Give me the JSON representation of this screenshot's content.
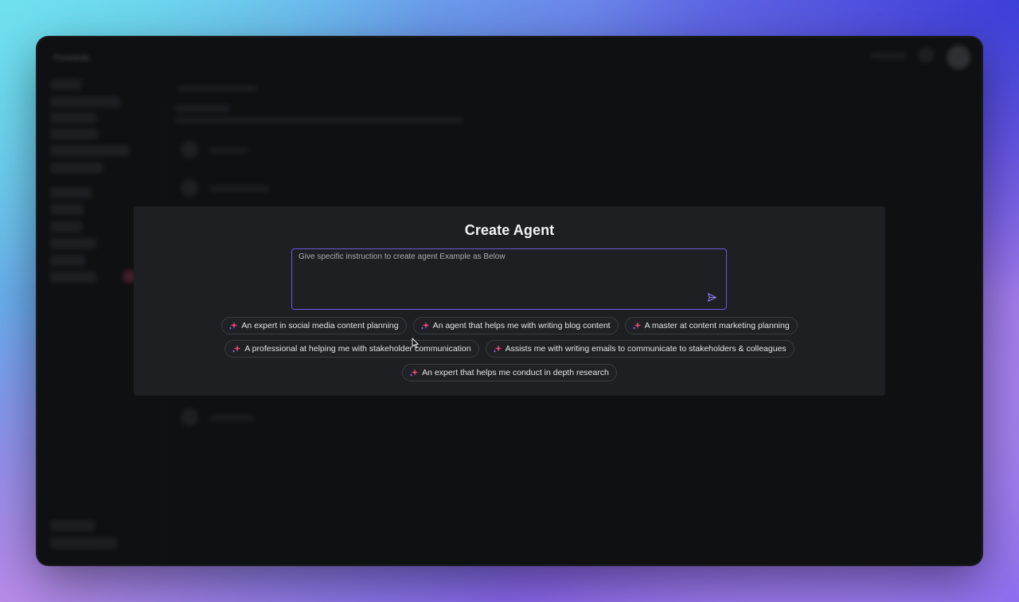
{
  "background_app": {
    "brand": "Forwards"
  },
  "modal": {
    "title": "Create Agent",
    "prompt": {
      "placeholder": "Give specific instruction to create agent Example as Below",
      "value": ""
    },
    "send_icon": "send-icon",
    "suggestions": [
      [
        {
          "label": "An expert in social media content planning",
          "icon": "sparkle-icon"
        },
        {
          "label": "An agent that helps me with writing blog content",
          "icon": "sparkle-icon"
        },
        {
          "label": "A master at content marketing planning",
          "icon": "sparkle-icon"
        }
      ],
      [
        {
          "label": "A professional at helping me with stakeholder communication",
          "icon": "sparkle-icon"
        },
        {
          "label": "Assists me with writing emails to communicate to stakeholders & colleagues",
          "icon": "sparkle-icon"
        }
      ],
      [
        {
          "label": "An expert that helps me conduct in depth research",
          "icon": "sparkle-icon"
        }
      ]
    ]
  },
  "colors": {
    "accent": "#6b5ae0",
    "sparkle_pink": "#e8477a",
    "sparkle_purple": "#9a6cf0",
    "modal_bg": "#1d1f22",
    "app_bg": "#0f1012"
  }
}
